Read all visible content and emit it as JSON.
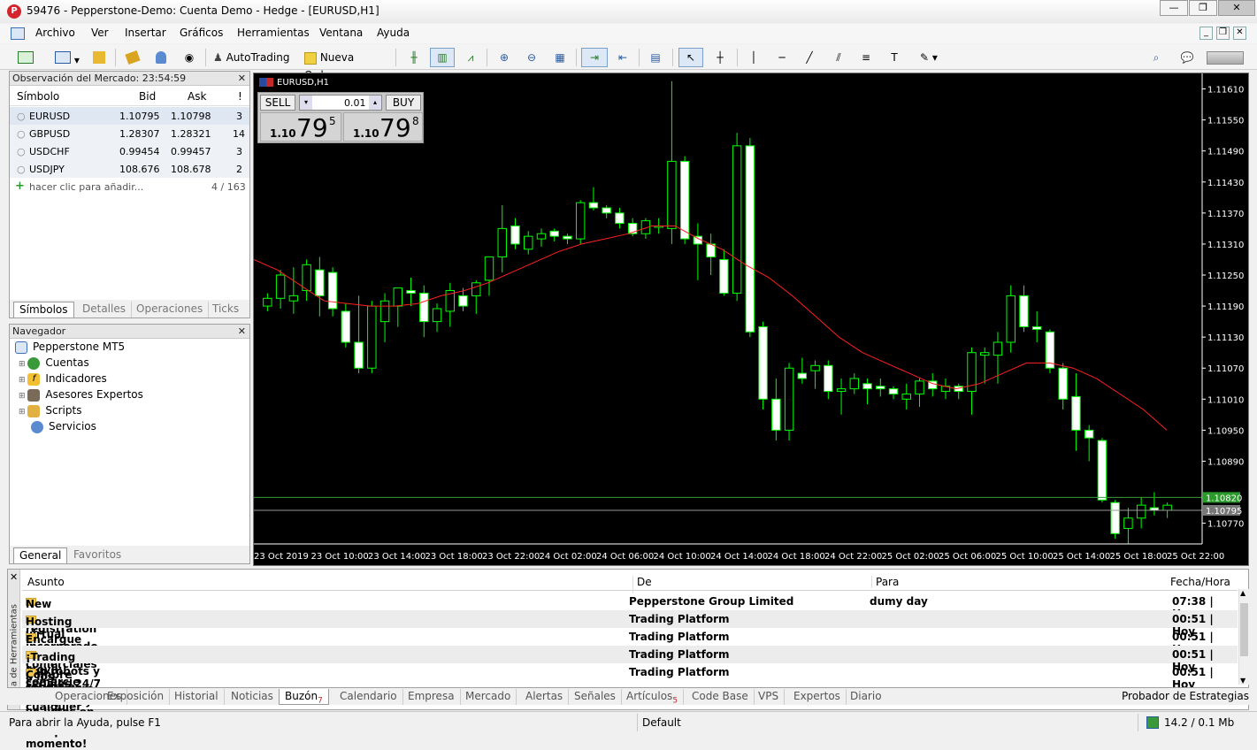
{
  "window": {
    "title": "59476 - Pepperstone-Demo: Cuenta Demo - Hedge - [EURUSD,H1]",
    "logo": "P"
  },
  "menu": [
    "Archivo",
    "Ver",
    "Insertar",
    "Gráficos",
    "Herramientas",
    "Ventana",
    "Ayuda"
  ],
  "toolbar": {
    "autotrading": "AutoTrading",
    "new_order": "Nueva Orden"
  },
  "market_watch": {
    "title": "Observación del Mercado: 23:54:59",
    "columns": [
      "Símbolo",
      "Bid",
      "Ask",
      "!"
    ],
    "rows": [
      {
        "symbol": "EURUSD",
        "bid": "1.10795",
        "ask": "1.10798",
        "spread": "3"
      },
      {
        "symbol": "GBPUSD",
        "bid": "1.28307",
        "ask": "1.28321",
        "spread": "14"
      },
      {
        "symbol": "USDCHF",
        "bid": "0.99454",
        "ask": "0.99457",
        "spread": "3"
      },
      {
        "symbol": "USDJPY",
        "bid": "108.676",
        "ask": "108.678",
        "spread": "2"
      }
    ],
    "add_label": "hacer clic para añadir...",
    "count": "4 / 163",
    "tabs": [
      "Símbolos",
      "Detalles",
      "Operaciones",
      "Ticks"
    ]
  },
  "navigator": {
    "title": "Navegador",
    "root": "Pepperstone MT5",
    "items": [
      "Cuentas",
      "Indicadores",
      "Asesores Expertos",
      "Scripts",
      "Servicios"
    ],
    "tabs": [
      "General",
      "Favoritos"
    ]
  },
  "chart": {
    "label": "EURUSD,H1",
    "sell": "SELL",
    "buy": "BUY",
    "volume": "0.01",
    "sell_price": {
      "small": "1.10",
      "big": "79",
      "sup": "5"
    },
    "buy_price": {
      "small": "1.10",
      "big": "79",
      "sup": "8"
    },
    "y_labels": [
      "1.11610",
      "1.11550",
      "1.11490",
      "1.11430",
      "1.11370",
      "1.11310",
      "1.11250",
      "1.11190",
      "1.11130",
      "1.11070",
      "1.11010",
      "1.10950",
      "1.10890",
      "1.10770"
    ],
    "ask_line": "1.10820",
    "bid_line": "1.10795",
    "x_labels": [
      "23 Oct 2019",
      "23 Oct 10:00",
      "23 Oct 14:00",
      "23 Oct 18:00",
      "23 Oct 22:00",
      "24 Oct 02:00",
      "24 Oct 06:00",
      "24 Oct 10:00",
      "24 Oct 14:00",
      "24 Oct 18:00",
      "24 Oct 22:00",
      "25 Oct 02:00",
      "25 Oct 06:00",
      "25 Oct 10:00",
      "25 Oct 14:00",
      "25 Oct 18:00",
      "25 Oct 22:00"
    ],
    "colors": {
      "bg": "#000000",
      "bull": "#ffffff",
      "wick": "#00ff00",
      "ma": "#ff2020",
      "grid_text": "#ffffff"
    }
  },
  "chart_data": {
    "type": "candlestick",
    "ohlc": [
      [
        1.1119,
        1.11215,
        1.1118,
        1.11205
      ],
      [
        1.11205,
        1.1126,
        1.11185,
        1.1125
      ],
      [
        1.112,
        1.11265,
        1.11175,
        1.1121
      ],
      [
        1.1122,
        1.1128,
        1.112,
        1.1127
      ],
      [
        1.1126,
        1.11285,
        1.1117,
        1.1121
      ],
      [
        1.11255,
        1.11265,
        1.1117,
        1.11185
      ],
      [
        1.1118,
        1.11195,
        1.1111,
        1.1112
      ],
      [
        1.1112,
        1.1121,
        1.1106,
        1.1107
      ],
      [
        1.1107,
        1.112,
        1.1106,
        1.1119
      ],
      [
        1.1116,
        1.11215,
        1.1112,
        1.112
      ],
      [
        1.1119,
        1.11225,
        1.1115,
        1.11225
      ],
      [
        1.1122,
        1.11245,
        1.1119,
        1.11215
      ],
      [
        1.11215,
        1.1123,
        1.1113,
        1.1116
      ],
      [
        1.1116,
        1.11195,
        1.1114,
        1.11185
      ],
      [
        1.1118,
        1.11235,
        1.1115,
        1.1122
      ],
      [
        1.1121,
        1.11225,
        1.1118,
        1.1119
      ],
      [
        1.1121,
        1.1124,
        1.11175,
        1.11235
      ],
      [
        1.1124,
        1.11285,
        1.1121,
        1.11285
      ],
      [
        1.11285,
        1.11385,
        1.11255,
        1.1134
      ],
      [
        1.11345,
        1.1136,
        1.113,
        1.1131
      ],
      [
        1.113,
        1.11335,
        1.1129,
        1.11325
      ],
      [
        1.1132,
        1.1134,
        1.11305,
        1.1133
      ],
      [
        1.11335,
        1.1134,
        1.11315,
        1.11325
      ],
      [
        1.11325,
        1.1133,
        1.1131,
        1.1132
      ],
      [
        1.1132,
        1.11395,
        1.1131,
        1.1139
      ],
      [
        1.1139,
        1.1142,
        1.11375,
        1.1138
      ],
      [
        1.1138,
        1.11385,
        1.1136,
        1.1137
      ],
      [
        1.1137,
        1.1138,
        1.1134,
        1.1135
      ],
      [
        1.1135,
        1.1136,
        1.11325,
        1.1133
      ],
      [
        1.1133,
        1.1136,
        1.1132,
        1.11355
      ],
      [
        1.11345,
        1.1136,
        1.1133,
        1.11345
      ],
      [
        1.1134,
        1.11625,
        1.1131,
        1.1147
      ],
      [
        1.1147,
        1.1148,
        1.1131,
        1.1132
      ],
      [
        1.11325,
        1.1135,
        1.1124,
        1.1131
      ],
      [
        1.1131,
        1.1133,
        1.1125,
        1.11285
      ],
      [
        1.1128,
        1.113,
        1.1121,
        1.11215
      ],
      [
        1.11215,
        1.11525,
        1.112,
        1.115
      ],
      [
        1.115,
        1.11515,
        1.1113,
        1.1114
      ],
      [
        1.1115,
        1.1116,
        1.1099,
        1.1101
      ],
      [
        1.1101,
        1.1105,
        1.1093,
        1.1095
      ],
      [
        1.1095,
        1.1108,
        1.1093,
        1.1107
      ],
      [
        1.1106,
        1.1109,
        1.1104,
        1.1105
      ],
      [
        1.11065,
        1.11085,
        1.1103,
        1.11075
      ],
      [
        1.11075,
        1.11085,
        1.1101,
        1.11025
      ],
      [
        1.11025,
        1.1105,
        1.1098,
        1.1103
      ],
      [
        1.1103,
        1.1106,
        1.1102,
        1.1105
      ],
      [
        1.1104,
        1.1105,
        1.11,
        1.1103
      ],
      [
        1.11035,
        1.1105,
        1.11015,
        1.1103
      ],
      [
        1.1103,
        1.11035,
        1.1101,
        1.1102
      ],
      [
        1.1101,
        1.1104,
        1.1099,
        1.1102
      ],
      [
        1.1102,
        1.1105,
        1.10995,
        1.11045
      ],
      [
        1.11045,
        1.1106,
        1.11015,
        1.1103
      ],
      [
        1.11025,
        1.1105,
        1.1101,
        1.11035
      ],
      [
        1.11035,
        1.1104,
        1.1101,
        1.11025
      ],
      [
        1.11025,
        1.1111,
        1.1098,
        1.111
      ],
      [
        1.11095,
        1.1111,
        1.1104,
        1.111
      ],
      [
        1.11095,
        1.1114,
        1.1104,
        1.1112
      ],
      [
        1.1112,
        1.1123,
        1.111,
        1.1121
      ],
      [
        1.1121,
        1.1123,
        1.1114,
        1.1115
      ],
      [
        1.1115,
        1.1118,
        1.1112,
        1.11145
      ],
      [
        1.1114,
        1.11145,
        1.1106,
        1.1107
      ],
      [
        1.1107,
        1.1108,
        1.1099,
        1.1101
      ],
      [
        1.11015,
        1.1106,
        1.1091,
        1.1095
      ],
      [
        1.1095,
        1.1096,
        1.1089,
        1.10935
      ],
      [
        1.1093,
        1.10935,
        1.1081,
        1.10815
      ],
      [
        1.1081,
        1.10815,
        1.1074,
        1.1075
      ],
      [
        1.1076,
        1.108,
        1.1073,
        1.1078
      ],
      [
        1.1078,
        1.1082,
        1.1076,
        1.10805
      ],
      [
        1.108,
        1.1083,
        1.10785,
        1.10795
      ],
      [
        1.10795,
        1.1081,
        1.1078,
        1.10805
      ]
    ],
    "moving_average": [
      1.1128,
      1.1126,
      1.1123,
      1.112,
      1.11195,
      1.1119,
      1.1119,
      1.11195,
      1.1121,
      1.1122,
      1.11235,
      1.11255,
      1.11275,
      1.11295,
      1.1131,
      1.1132,
      1.1133,
      1.11345,
      1.11345,
      1.1132,
      1.113,
      1.1127,
      1.11245,
      1.1121,
      1.1117,
      1.1113,
      1.111,
      1.1108,
      1.1106,
      1.1104,
      1.1103,
      1.1104,
      1.1106,
      1.1108,
      1.1108,
      1.1107,
      1.1105,
      1.1102,
      1.1099,
      1.1095
    ],
    "ylim": [
      1.1073,
      1.1164
    ],
    "y_ticks": [
      1.1161,
      1.1155,
      1.1149,
      1.1143,
      1.1137,
      1.1131,
      1.1125,
      1.1119,
      1.1113,
      1.1107,
      1.1101,
      1.1095,
      1.1089,
      1.1077
    ]
  },
  "toolbox": {
    "side_label": "Caja de Herramientas",
    "columns": [
      "Asunto",
      "De",
      "Para",
      "Fecha/Hora"
    ],
    "mails": [
      {
        "subject": "New account registration",
        "from": "Pepperstone Group Limited",
        "to": "dumy day",
        "time": "07:38 | Hoy"
      },
      {
        "subject": "Hosting virtual incorporado, comercio con robots y señales 24/7",
        "from": "Trading Platform",
        "to": "",
        "time": "00:51 | Hoy"
      },
      {
        "subject": "Encargue robots comerciales a los freelancers, es rápido y efectivo",
        "from": "Trading Platform",
        "to": "",
        "time": "00:51 | Hoy"
      },
      {
        "subject": "¡Trading móvil: comercie desde cualquier lugar y en cualquier momento!",
        "from": "Trading Platform",
        "to": "",
        "time": "00:51 | Hoy"
      },
      {
        "subject": "Compre robots e indicadores ya listos en el Mercado",
        "from": "Trading Platform",
        "to": "",
        "time": "00:51 | Hoy"
      }
    ],
    "tabs": [
      "Operaciones",
      "Exposición",
      "Historial",
      "Noticias",
      "Buzón",
      "Calendario",
      "Empresa",
      "Mercado",
      "Alertas",
      "Señales",
      "Artículos",
      "Code Base",
      "VPS",
      "Expertos",
      "Diario"
    ],
    "buzon_badge": "7",
    "articulos_badge": "5",
    "strategy_tester": "Probador de Estrategias"
  },
  "status": {
    "help": "Para abrir la Ayuda, pulse F1",
    "profile": "Default",
    "traffic": "14.2 / 0.1 Mb"
  }
}
